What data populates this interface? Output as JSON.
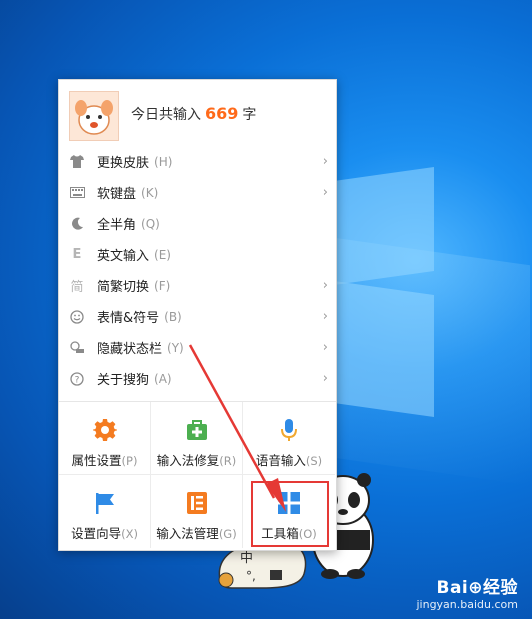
{
  "header": {
    "stat_prefix": "今日共输入",
    "stat_count": "669",
    "stat_suffix": "字"
  },
  "menu_items": [
    {
      "label": "更换皮肤",
      "shortcut": "(H)",
      "icon": "shirt-icon",
      "submenu": true
    },
    {
      "label": "软键盘",
      "shortcut": "(K)",
      "icon": "keyboard-icon",
      "submenu": true
    },
    {
      "label": "全半角",
      "shortcut": "(Q)",
      "icon": "moon-icon",
      "submenu": false
    },
    {
      "label": "英文输入",
      "shortcut": "(E)",
      "icon": "letter-e-icon",
      "submenu": false
    },
    {
      "label": "简繁切换",
      "shortcut": "(F)",
      "icon": "simplified-char-icon",
      "submenu": true
    },
    {
      "label": "表情&符号",
      "shortcut": "(B)",
      "icon": "smiley-icon",
      "submenu": true
    },
    {
      "label": "隐藏状态栏",
      "shortcut": "(Y)",
      "icon": "hide-statusbar-icon",
      "submenu": true
    },
    {
      "label": "关于搜狗",
      "shortcut": "(A)",
      "icon": "question-icon",
      "submenu": true
    }
  ],
  "tools": [
    {
      "label": "属性设置",
      "shortcut": "(P)",
      "icon": "gear-icon",
      "color": "#f47b20"
    },
    {
      "label": "输入法修复",
      "shortcut": "(R)",
      "icon": "repair-kit-icon",
      "color": "#4caf50"
    },
    {
      "label": "语音输入",
      "shortcut": "(S)",
      "icon": "microphone-icon",
      "color": "#2f8be6"
    },
    {
      "label": "设置向导",
      "shortcut": "(X)",
      "icon": "flag-icon",
      "color": "#2f8be6"
    },
    {
      "label": "输入法管理",
      "shortcut": "(G)",
      "icon": "ime-manager-icon",
      "color": "#f47b20"
    },
    {
      "label": "工具箱",
      "shortcut": "(O)",
      "icon": "toolbox-grid-icon",
      "color": "#2f8be6"
    }
  ],
  "colors": {
    "accent_orange": "#ff6a1a",
    "highlight_red": "#e53935",
    "desktop_blue": "#0a6fd6"
  },
  "status_bar": {
    "mode": "中"
  },
  "watermark": {
    "logo": "Bai⊕经验",
    "url": "jingyan.baidu.com"
  }
}
